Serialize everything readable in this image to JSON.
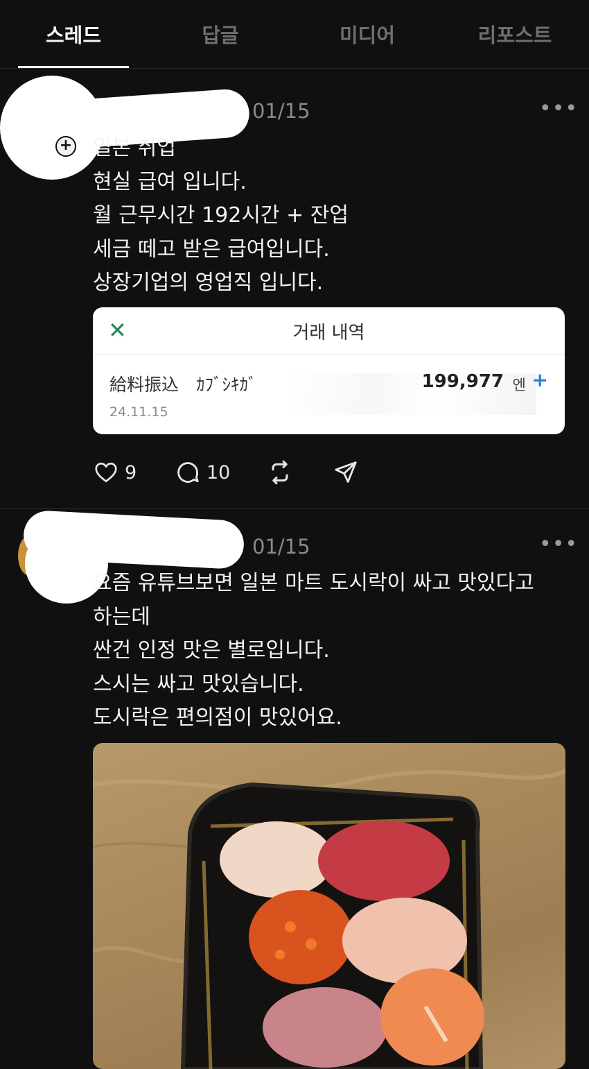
{
  "tabs": [
    {
      "label": "스레드",
      "active": true
    },
    {
      "label": "답글",
      "active": false
    },
    {
      "label": "미디어",
      "active": false
    },
    {
      "label": "리포스트",
      "active": false
    }
  ],
  "posts": [
    {
      "timestamp": "01/15",
      "lines": [
        "일본 취업",
        "현실 급여 입니다.",
        "월 근무시간 192시간 + 잔업",
        "세금 떼고 받은 급여입니다.",
        "상장기업의 영업직 입니다."
      ],
      "card": {
        "title": "거래 내역",
        "description": "給料振込　ｶﾌﾞｼｷｶﾞ",
        "date": "24.11.15",
        "amount": "199,977",
        "unit": "엔",
        "plus": "+"
      },
      "likes": "9",
      "replies": "10"
    },
    {
      "timestamp": "01/15",
      "lines": [
        "요즘 유튜브보면 일본 마트 도시락이 싸고 맛있다고",
        "하는데",
        "싼건 인정 맛은 별로입니다.",
        "스시는 싸고 맛있습니다.",
        "도시락은 편의점이 맛있어요."
      ]
    }
  ],
  "colors": {
    "background": "#101010",
    "text": "#f3f3f3",
    "muted": "#8a8a8a",
    "card_close": "#1f8a5b",
    "card_plus": "#2a7de1"
  },
  "icons": [
    "plus-icon",
    "more-icon",
    "close-icon",
    "heart-icon",
    "comment-icon",
    "repost-icon",
    "share-icon"
  ]
}
